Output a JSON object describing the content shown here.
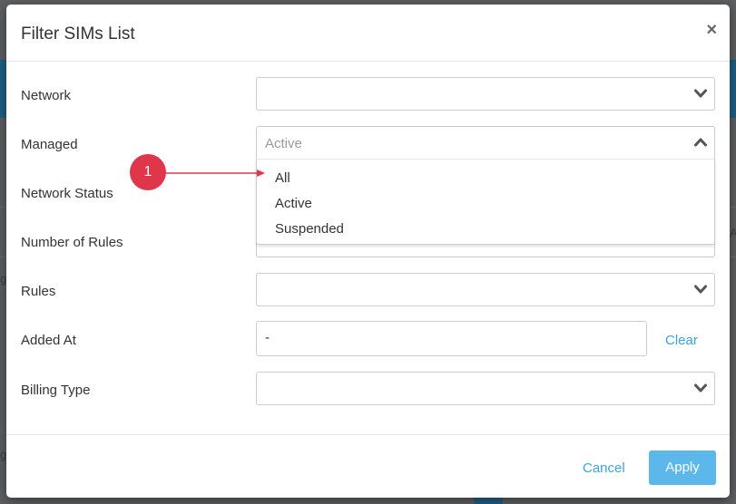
{
  "modal": {
    "title": "Filter SIMs List",
    "close_label": "×"
  },
  "form": {
    "network_label": "Network",
    "managed_label": "Managed",
    "network_status_label": "Network Status",
    "number_of_rules_label": "Number of Rules",
    "rules_label": "Rules",
    "added_at_label": "Added At",
    "billing_type_label": "Billing Type",
    "managed_value": "Active",
    "added_at_value": "-",
    "clear_label": "Clear"
  },
  "dropdown": {
    "options": [
      "All",
      "Active",
      "Suspended"
    ]
  },
  "footer": {
    "cancel_label": "Cancel",
    "apply_label": "Apply"
  },
  "callout": {
    "number": "1"
  },
  "background": {
    "edge_text_right": "A",
    "edge_text_left": "g"
  },
  "colors": {
    "accent": "#3aa5dc",
    "apply_bg": "#5cb8eb",
    "callout": "#e0364a"
  }
}
